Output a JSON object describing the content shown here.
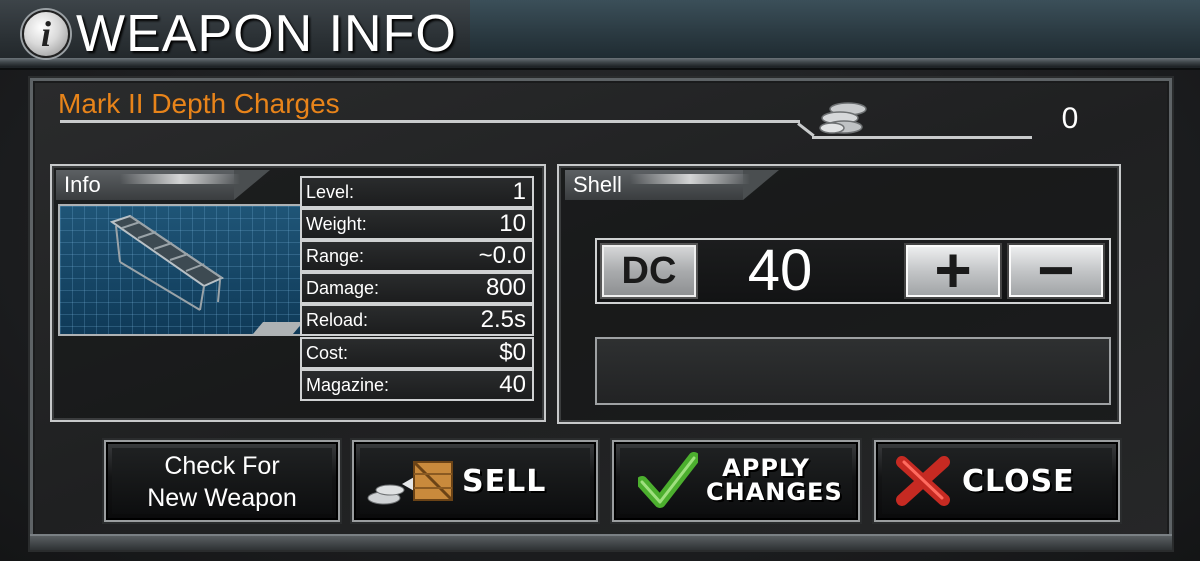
{
  "header": {
    "title": "WEAPON INFO",
    "info_icon_glyph": "i"
  },
  "weapon": {
    "name": "Mark II Depth Charges"
  },
  "currency": {
    "balance": "0"
  },
  "info_panel": {
    "tab_label": "Info",
    "stats": [
      {
        "label": "Level:",
        "value": "1"
      },
      {
        "label": "Weight:",
        "value": "10"
      },
      {
        "label": "Range:",
        "value": "~0.0"
      },
      {
        "label": "Damage:",
        "value": "800"
      },
      {
        "label": "Reload:",
        "value": "2.5s"
      },
      {
        "label": "Cost:",
        "value": "$0"
      },
      {
        "label": "Magazine:",
        "value": "40"
      }
    ]
  },
  "shell_panel": {
    "tab_label": "Shell",
    "ammo_type": "DC",
    "ammo_count": "40",
    "plus_symbol": "+",
    "minus_symbol": "−"
  },
  "buttons": {
    "check": "Check For\nNew Weapon",
    "sell": "SELL",
    "apply": "APPLY\nCHANGES",
    "close": "CLOSE"
  },
  "colors": {
    "weapon_name": "#e8841a",
    "apply_check": "#4caf2e",
    "close_x": "#c62a22"
  },
  "icons": [
    "info-icon",
    "coins-icon",
    "depth-charge-rack-icon",
    "crate-icon",
    "checkmark-icon",
    "x-icon"
  ]
}
